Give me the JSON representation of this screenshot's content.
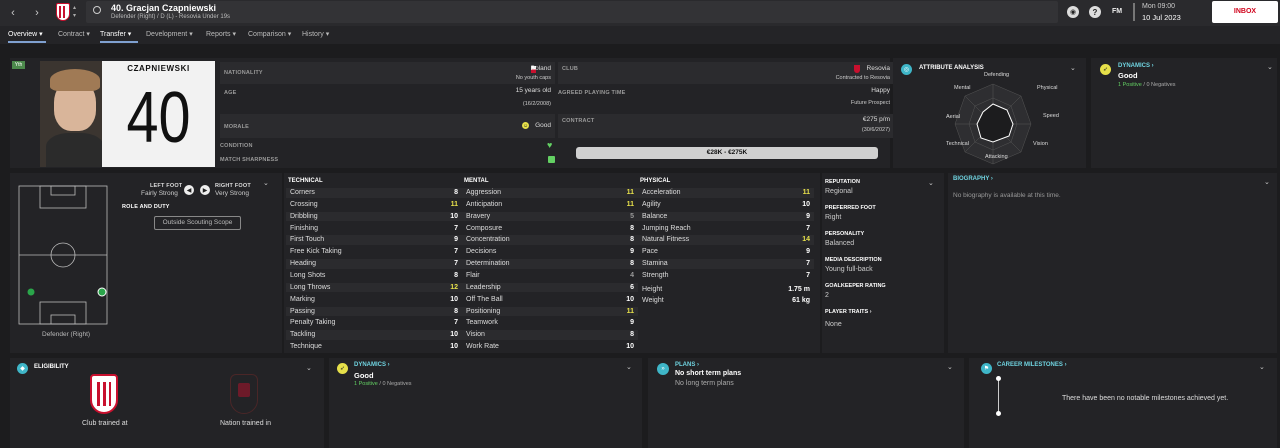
{
  "header": {
    "player_title": "40. Gracjan Czapniewski",
    "player_subtitle": "Defender (Right) / D (L) - Resovia Under 19s",
    "fm_label": "FM",
    "date_line1": "Mon 09:00",
    "date_line2": "10 Jul 2023",
    "inbox_label": "INBOX"
  },
  "tabs": [
    {
      "label": "Overview"
    },
    {
      "label": "Contract"
    },
    {
      "label": "Transfer"
    },
    {
      "label": "Development"
    },
    {
      "label": "Reports"
    },
    {
      "label": "Comparison"
    },
    {
      "label": "History"
    }
  ],
  "badge": "Yth",
  "shirt": {
    "name": "CZAPNIEWSKI",
    "number": "40"
  },
  "info": {
    "nationality_label": "NATIONALITY",
    "nationality": "Poland",
    "nationality_sub": "No youth caps",
    "club_label": "CLUB",
    "club": "Resovia",
    "club_sub": "Contracted to Resovia",
    "age_label": "AGE",
    "age": "15 years old",
    "dob": "(16/2/2008)",
    "agreed_label": "AGREED PLAYING TIME",
    "agreed": "Happy",
    "agreed_sub": "Future Prospect",
    "morale_label": "MORALE",
    "morale": "Good",
    "contract_label": "CONTRACT",
    "contract": "€275 p/m",
    "contract_sub": "(30/6/2027)",
    "condition_label": "CONDITION",
    "sharpness_label": "MATCH SHARPNESS",
    "value_range": "€28K - €275K"
  },
  "attr_analysis": {
    "title": "ATTRIBUTE ANALYSIS",
    "labels": {
      "defending": "Defending",
      "physical": "Physical",
      "speed": "Speed",
      "vision": "Vision",
      "attacking": "Attacking",
      "technical": "Technical",
      "aerial": "Aerial",
      "mental": "Mental"
    }
  },
  "dynamics_top": {
    "title": "DYNAMICS",
    "value": "Good",
    "positive": "1 Positive",
    "sep": "/",
    "negative": "0 Negatives"
  },
  "feet": {
    "left_label": "LEFT FOOT",
    "left_value": "Fairly Strong",
    "right_label": "RIGHT FOOT",
    "right_value": "Very Strong"
  },
  "role": {
    "label": "ROLE AND DUTY",
    "button": "Outside Scouting Scope",
    "position": "Defender (Right)"
  },
  "technical": {
    "title": "TECHNICAL",
    "rows": [
      {
        "name": "Corners",
        "value": "8"
      },
      {
        "name": "Crossing",
        "value": "11"
      },
      {
        "name": "Dribbling",
        "value": "10"
      },
      {
        "name": "Finishing",
        "value": "7"
      },
      {
        "name": "First Touch",
        "value": "9"
      },
      {
        "name": "Free Kick Taking",
        "value": "7"
      },
      {
        "name": "Heading",
        "value": "7"
      },
      {
        "name": "Long Shots",
        "value": "8"
      },
      {
        "name": "Long Throws",
        "value": "12"
      },
      {
        "name": "Marking",
        "value": "10"
      },
      {
        "name": "Passing",
        "value": "8"
      },
      {
        "name": "Penalty Taking",
        "value": "7"
      },
      {
        "name": "Tackling",
        "value": "10"
      },
      {
        "name": "Technique",
        "value": "10"
      }
    ]
  },
  "mental": {
    "title": "MENTAL",
    "rows": [
      {
        "name": "Aggression",
        "value": "11"
      },
      {
        "name": "Anticipation",
        "value": "11"
      },
      {
        "name": "Bravery",
        "value": "5"
      },
      {
        "name": "Composure",
        "value": "8"
      },
      {
        "name": "Concentration",
        "value": "8"
      },
      {
        "name": "Decisions",
        "value": "9"
      },
      {
        "name": "Determination",
        "value": "8"
      },
      {
        "name": "Flair",
        "value": "4"
      },
      {
        "name": "Leadership",
        "value": "6"
      },
      {
        "name": "Off The Ball",
        "value": "10"
      },
      {
        "name": "Positioning",
        "value": "11"
      },
      {
        "name": "Teamwork",
        "value": "9"
      },
      {
        "name": "Vision",
        "value": "8"
      },
      {
        "name": "Work Rate",
        "value": "10"
      }
    ]
  },
  "physical": {
    "title": "PHYSICAL",
    "rows": [
      {
        "name": "Acceleration",
        "value": "11"
      },
      {
        "name": "Agility",
        "value": "10"
      },
      {
        "name": "Balance",
        "value": "9"
      },
      {
        "name": "Jumping Reach",
        "value": "7"
      },
      {
        "name": "Natural Fitness",
        "value": "14"
      },
      {
        "name": "Pace",
        "value": "9"
      },
      {
        "name": "Stamina",
        "value": "7"
      },
      {
        "name": "Strength",
        "value": "7"
      }
    ],
    "height_label": "Height",
    "height": "1.75 m",
    "weight_label": "Weight",
    "weight": "61 kg"
  },
  "side_info": {
    "reputation_label": "REPUTATION",
    "reputation": "Regional",
    "pref_foot_label": "PREFERRED FOOT",
    "pref_foot": "Right",
    "personality_label": "PERSONALITY",
    "personality": "Balanced",
    "media_label": "MEDIA DESCRIPTION",
    "media": "Young full-back",
    "gk_label": "GOALKEEPER RATING",
    "gk": "2",
    "traits_label": "PLAYER TRAITS",
    "traits": "None"
  },
  "biography": {
    "title": "BIOGRAPHY",
    "text": "No biography is available at this time."
  },
  "eligibility": {
    "title": "ELIGIBILITY",
    "club_caption": "Club trained at",
    "nation_caption": "Nation trained in"
  },
  "dynamics_bottom": {
    "title": "DYNAMICS",
    "value": "Good",
    "positive": "1 Positive",
    "sep": "/",
    "negative": "0 Negatives"
  },
  "plans": {
    "title": "PLANS",
    "short": "No short term plans",
    "long": "No long term plans"
  },
  "milestones": {
    "title": "CAREER MILESTONES",
    "text": "There have been no notable milestones achieved yet."
  },
  "colors": {
    "accent": "#e6e04a",
    "positive": "#63d063",
    "teal": "#3fb6c8",
    "red": "#c8102e"
  }
}
